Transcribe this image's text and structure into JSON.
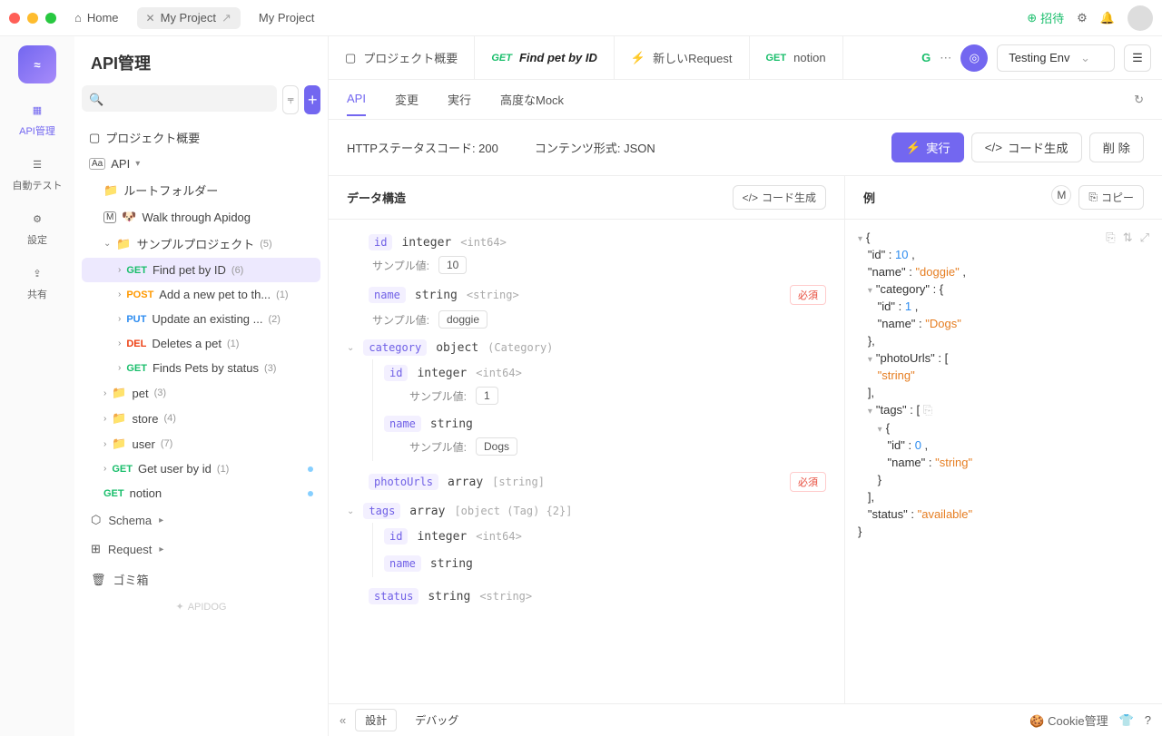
{
  "titlebar": {
    "home": "Home",
    "tab1": "My Project",
    "tab2": "My Project",
    "invite": "招待"
  },
  "rail": {
    "api": "API管理",
    "autotest": "自動テスト",
    "settings": "設定",
    "share": "共有"
  },
  "sidebar": {
    "title": "API管理",
    "projectOverview": "プロジェクト概要",
    "api": "API",
    "rootFolder": "ルートフォルダー",
    "walkThrough": "Walk through Apidog",
    "sampleProject": "サンプルプロジェクト",
    "sampleCount": "(5)",
    "items": [
      {
        "method": "GET",
        "label": "Find pet by ID",
        "count": "(6)"
      },
      {
        "method": "POST",
        "label": "Add a new pet to th...",
        "count": "(1)"
      },
      {
        "method": "PUT",
        "label": "Update an existing ...",
        "count": "(2)"
      },
      {
        "method": "DEL",
        "label": "Deletes a pet",
        "count": "(1)"
      },
      {
        "method": "GET",
        "label": "Finds Pets by status",
        "count": "(3)"
      }
    ],
    "folders": [
      {
        "label": "pet",
        "count": "(3)"
      },
      {
        "label": "store",
        "count": "(4)"
      },
      {
        "label": "user",
        "count": "(7)"
      }
    ],
    "getUserById": "Get user by id",
    "getUserByIdCount": "(1)",
    "notion": "notion",
    "schema": "Schema",
    "request": "Request",
    "trash": "ゴミ箱",
    "brand": "APIDOG"
  },
  "tabs": {
    "overview": "プロジェクト概要",
    "active_method": "GET",
    "active_title": "Find pet by ID",
    "new_request": "新しいRequest",
    "notion_method": "GET",
    "notion": "notion",
    "g": "G",
    "env": "Testing Env"
  },
  "subnav": {
    "api": "API",
    "change": "変更",
    "run": "実行",
    "mock": "高度なMock"
  },
  "inforow": {
    "status": "HTTPステータスコード: 200",
    "content": "コンテンツ形式: JSON",
    "run": "実行",
    "codegen": "コード生成",
    "delete": "削 除"
  },
  "panels": {
    "structure": "データ構造",
    "codegen": "コード生成",
    "example": "例",
    "m_badge": "M",
    "copy": "コピー"
  },
  "schema": {
    "sampleLabel": "サンプル値:",
    "required": "必須",
    "fields": {
      "id": {
        "name": "id",
        "type": "integer",
        "format": "<int64>",
        "sample": "10"
      },
      "name": {
        "name": "name",
        "type": "string",
        "format": "<string>",
        "sample": "doggie"
      },
      "category": {
        "name": "category",
        "type": "object",
        "format": "(Category)"
      },
      "cat_id": {
        "name": "id",
        "type": "integer",
        "format": "<int64>",
        "sample": "1"
      },
      "cat_name": {
        "name": "name",
        "type": "string",
        "sample": "Dogs"
      },
      "photoUrls": {
        "name": "photoUrls",
        "type": "array",
        "format": "[string]"
      },
      "tags": {
        "name": "tags",
        "type": "array",
        "format": "[object (Tag) {2}]"
      },
      "tag_id": {
        "name": "id",
        "type": "integer",
        "format": "<int64>"
      },
      "tag_name": {
        "name": "name",
        "type": "string"
      },
      "status": {
        "name": "status",
        "type": "string",
        "format": "<string>"
      }
    }
  },
  "example_json": {
    "l1": "{",
    "l2": "\"id\" : ",
    "l2v": "10",
    "l2e": " ,",
    "l3": "\"name\" : ",
    "l3v": "\"doggie\"",
    "l3e": " ,",
    "l4": "\"category\" : {",
    "l5": "\"id\" : ",
    "l5v": "1",
    "l5e": " ,",
    "l6": "\"name\" : ",
    "l6v": "\"Dogs\"",
    "l7": "},",
    "l8": "\"photoUrls\" : [",
    "l9": "\"string\"",
    "l10": "],",
    "l11": "\"tags\" : [",
    "l12": "{",
    "l13": "\"id\" : ",
    "l13v": "0",
    "l13e": " ,",
    "l14": "\"name\" : ",
    "l14v": "\"string\"",
    "l15": "}",
    "l16": "],",
    "l17": "\"status\" : ",
    "l17v": "\"available\"",
    "l18": "}"
  },
  "footer": {
    "design": "設計",
    "debug": "デバッグ",
    "cookie": "Cookie管理"
  }
}
